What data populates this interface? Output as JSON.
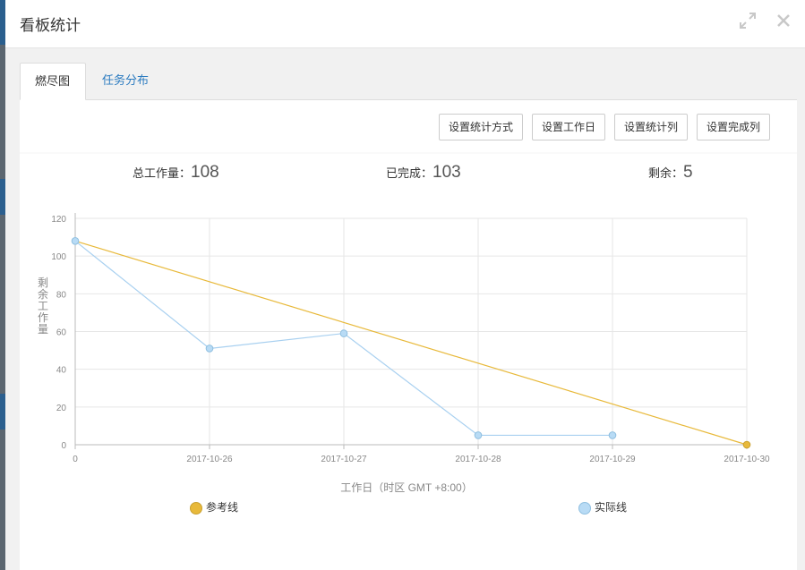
{
  "modal": {
    "title": "看板统计"
  },
  "tabs": [
    {
      "label": "燃尽图",
      "active": true
    },
    {
      "label": "任务分布",
      "active": false
    }
  ],
  "toolbar": {
    "buttons": [
      "设置统计方式",
      "设置工作日",
      "设置统计列",
      "设置完成列"
    ]
  },
  "summary": {
    "total_label": "总工作量：",
    "total_value": "108",
    "done_label": "已完成：",
    "done_value": "103",
    "remaining_label": "剩余：",
    "remaining_value": "5"
  },
  "chart_data": {
    "type": "line",
    "categories": [
      "0",
      "2017-10-26",
      "2017-10-27",
      "2017-10-28",
      "2017-10-29",
      "2017-10-30"
    ],
    "series": [
      {
        "name": "参考线",
        "color": "#f0c040",
        "values": [
          108,
          null,
          null,
          null,
          null,
          0
        ]
      },
      {
        "name": "实际线",
        "color": "#a8d0f0",
        "values": [
          108,
          51,
          59,
          5,
          5,
          null
        ]
      }
    ],
    "xlabel": "工作日（时区 GMT +8:00）",
    "ylabel": "剩余工作量",
    "ylim": [
      0,
      120
    ],
    "yticks": [
      0,
      20,
      40,
      60,
      80,
      100,
      120
    ],
    "grid": true,
    "legend": "bottom"
  },
  "colors": {
    "reference": "#e8b93a",
    "actual": "#a8d0f0",
    "actual_dot": "#b8dbf5",
    "link": "#2b7bc0"
  }
}
